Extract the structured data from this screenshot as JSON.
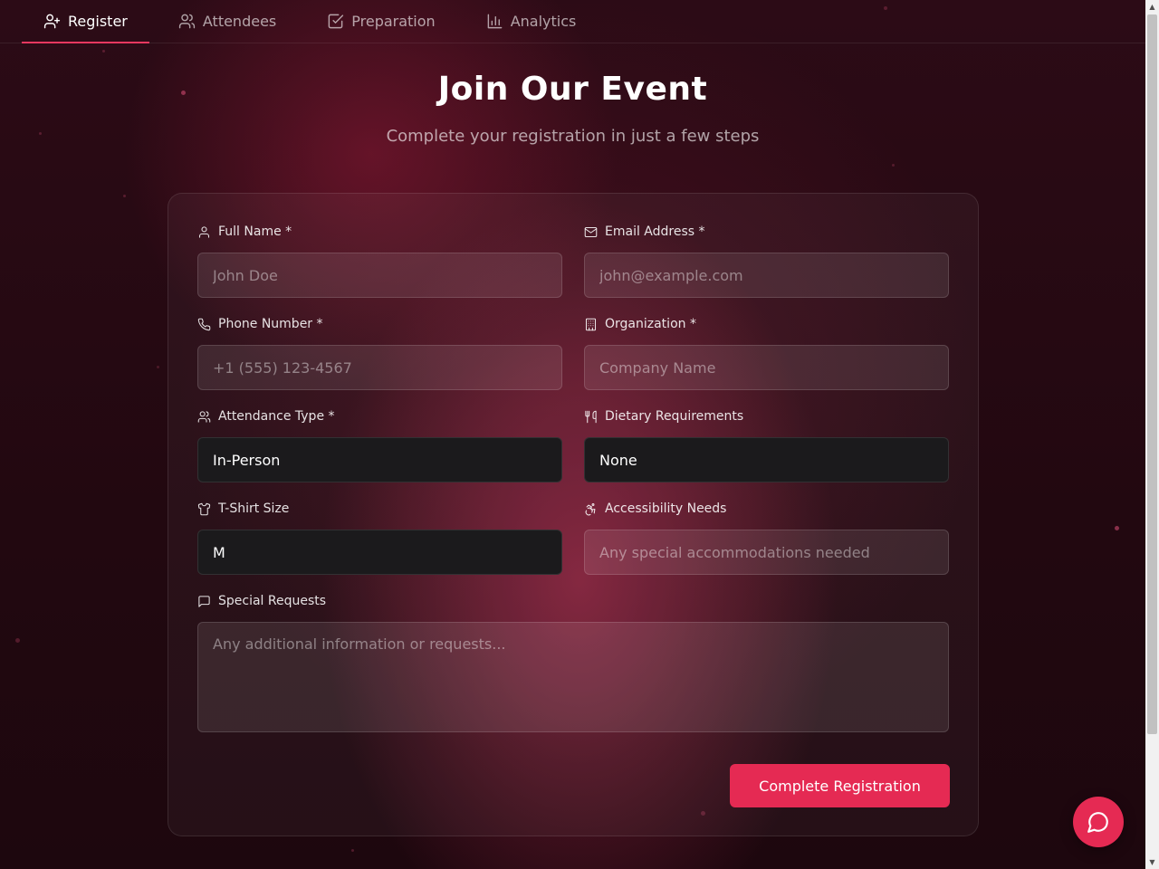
{
  "nav": {
    "tabs": [
      {
        "label": "Register",
        "icon": "user-plus-icon",
        "active": true
      },
      {
        "label": "Attendees",
        "icon": "users-icon",
        "active": false
      },
      {
        "label": "Preparation",
        "icon": "checkbox-icon",
        "active": false
      },
      {
        "label": "Analytics",
        "icon": "bar-chart-icon",
        "active": false
      }
    ]
  },
  "hero": {
    "title": "Join Our Event",
    "subtitle": "Complete your registration in just a few steps"
  },
  "form": {
    "full_name": {
      "label": "Full Name *",
      "placeholder": "John Doe",
      "value": ""
    },
    "email": {
      "label": "Email Address *",
      "placeholder": "john@example.com",
      "value": ""
    },
    "phone": {
      "label": "Phone Number *",
      "placeholder": "+1 (555) 123-4567",
      "value": ""
    },
    "organization": {
      "label": "Organization *",
      "placeholder": "Company Name",
      "value": ""
    },
    "attendance_type": {
      "label": "Attendance Type *",
      "value": "In-Person"
    },
    "dietary": {
      "label": "Dietary Requirements",
      "value": "None"
    },
    "tshirt": {
      "label": "T-Shirt Size",
      "value": "M"
    },
    "accessibility": {
      "label": "Accessibility Needs",
      "placeholder": "Any special accommodations needed",
      "value": ""
    },
    "special_requests": {
      "label": "Special Requests",
      "placeholder": "Any additional information or requests...",
      "value": ""
    },
    "submit_label": "Complete Registration"
  },
  "colors": {
    "accent": "#e52a53",
    "background": "#220810"
  },
  "chat": {
    "icon": "message-circle-icon"
  }
}
